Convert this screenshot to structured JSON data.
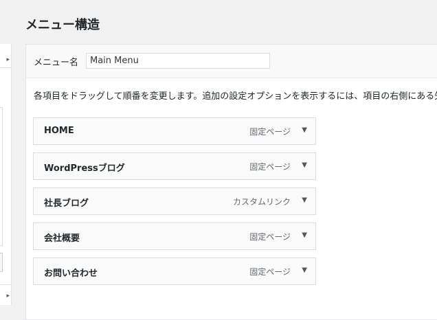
{
  "page_title": "メニュー構造",
  "menu_name": {
    "label": "メニュー名",
    "value": "Main Menu"
  },
  "instructions": "各項目をドラッグして順番を変更します。追加の設定オプションを表示するには、項目の右側にある矢",
  "menu_items": [
    {
      "title": "HOME",
      "type": "固定ページ"
    },
    {
      "title": "WordPressブログ",
      "type": "固定ページ"
    },
    {
      "title": "社長ブログ",
      "type": "カスタムリンク"
    },
    {
      "title": "会社概要",
      "type": "固定ページ"
    },
    {
      "title": "お問い合わせ",
      "type": "固定ページ"
    }
  ],
  "icons": {
    "toggle": "▼",
    "left_arrow": "▸"
  }
}
